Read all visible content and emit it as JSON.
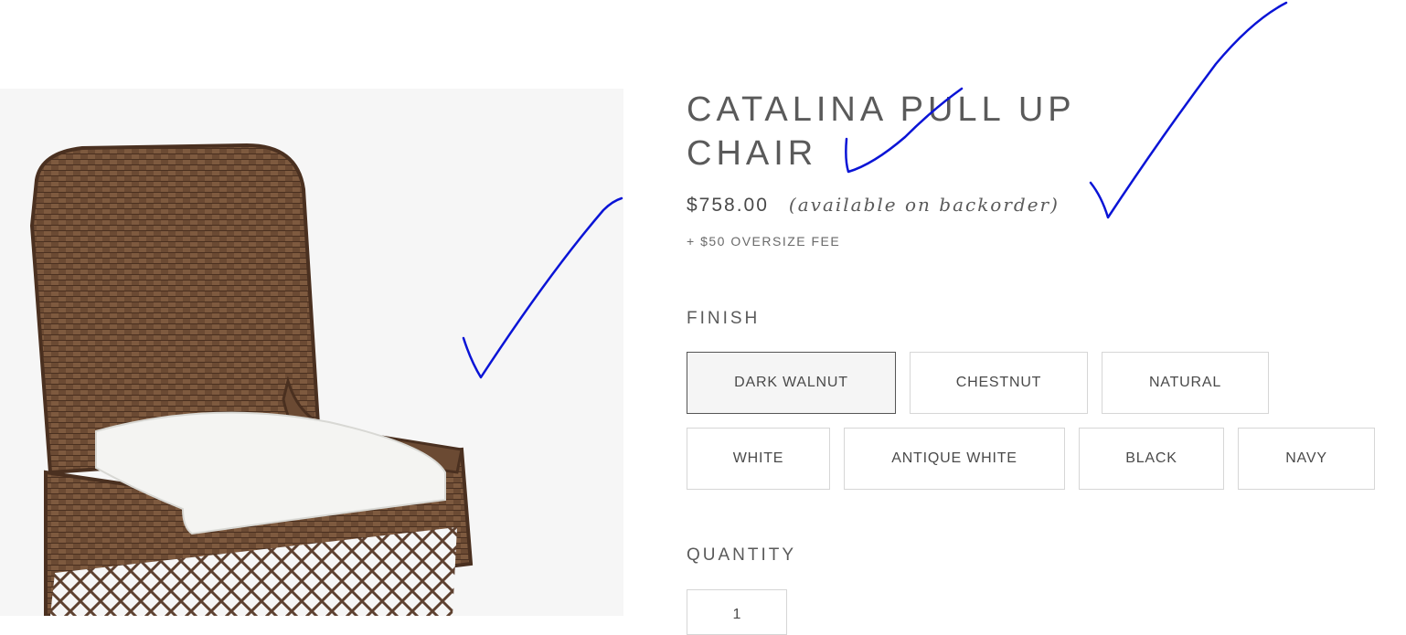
{
  "product": {
    "title_line1": "CATALINA PULL UP",
    "title_line2": "CHAIR",
    "price": "$758.00",
    "availability": "(available on backorder)",
    "fee": "+ $50 OVERSIZE FEE"
  },
  "image": {
    "icon": "wicker-chair-icon"
  },
  "finish": {
    "label": "FINISH",
    "selected": "DARK WALNUT",
    "options": [
      "DARK WALNUT",
      "CHESTNUT",
      "NATURAL",
      "WHITE",
      "ANTIQUE WHITE",
      "BLACK",
      "NAVY"
    ]
  },
  "quantity": {
    "label": "QUANTITY",
    "value": "1"
  },
  "colors": {
    "text": "#5a5a5a",
    "image_background": "#f6f6f6",
    "swatch_border": "#d6d6d6",
    "selected_border": "#555555",
    "annotation_ink": "#0a14d6",
    "wicker": "#6b4a33",
    "cushion": "#f4f4f2"
  },
  "annotations": {
    "icon": "checkmark-icon",
    "count": 3
  }
}
